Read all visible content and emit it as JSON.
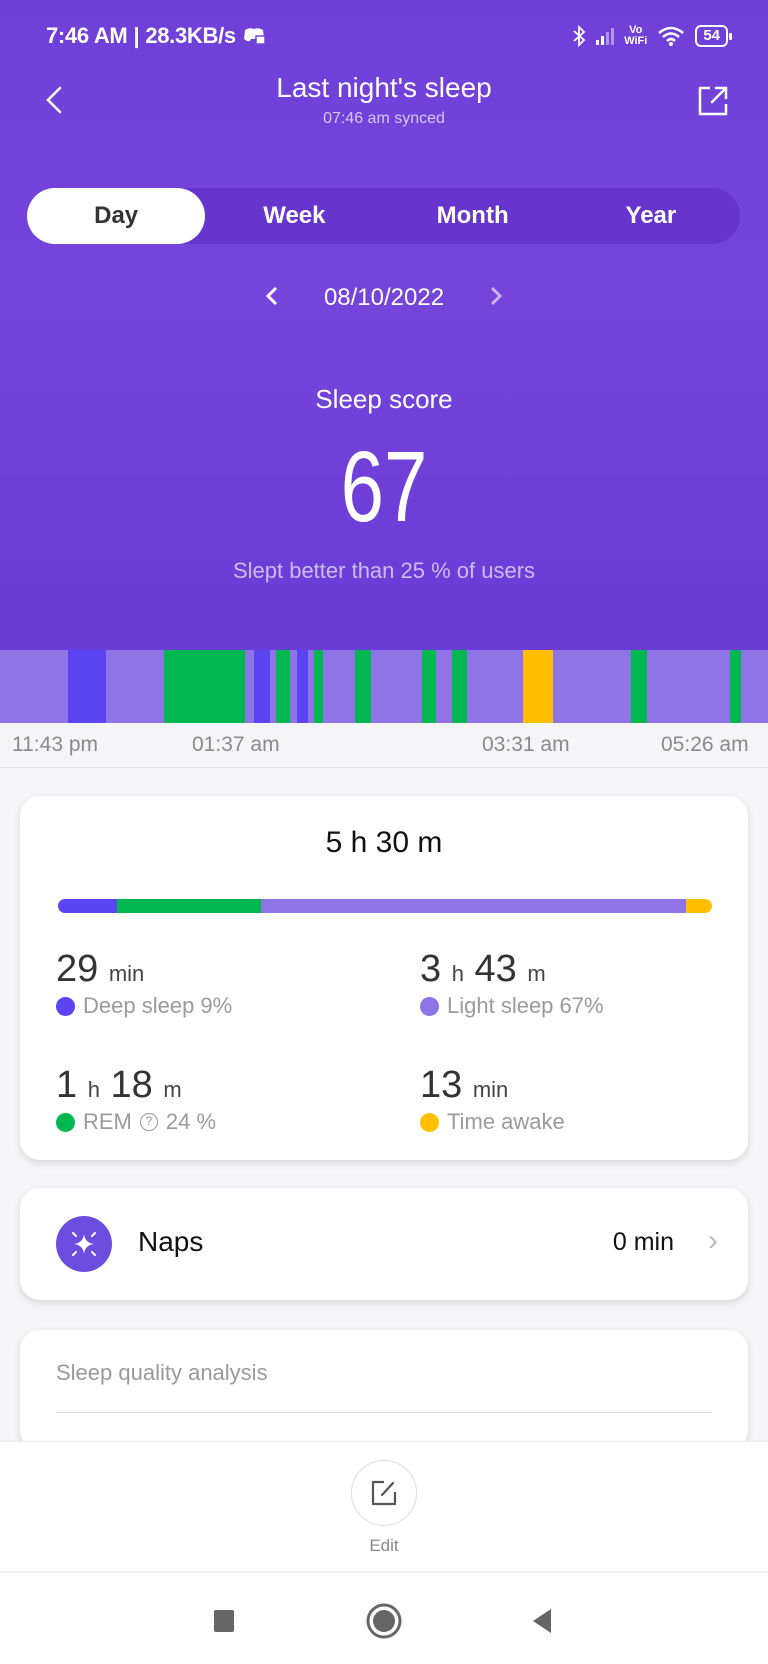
{
  "status_bar": {
    "time": "7:46 AM",
    "network_speed": "28.3KB/s",
    "vowifi_label": "Vo\nWiFi",
    "battery": "54",
    "icons": [
      "discord-icon",
      "bluetooth-icon",
      "signal-icon",
      "vowifi-icon",
      "wifi-icon",
      "battery-icon"
    ]
  },
  "header": {
    "title": "Last night's sleep",
    "subtitle": "07:46 am synced",
    "back_icon": "chevron-left-icon",
    "share_icon": "share-icon"
  },
  "tabs": [
    {
      "label": "Day",
      "active": true
    },
    {
      "label": "Week",
      "active": false
    },
    {
      "label": "Month",
      "active": false
    },
    {
      "label": "Year",
      "active": false
    }
  ],
  "date_nav": {
    "date": "08/10/2022",
    "prev_icon": "chevron-left-icon",
    "next_icon": "chevron-right-icon"
  },
  "score": {
    "label": "Sleep score",
    "value": "67",
    "comparison": "Slept better than 25 % of users"
  },
  "colors": {
    "deep": "#5b44f2",
    "light": "#8f74e8",
    "rem": "#00b84f",
    "awake": "#ffbf00",
    "brand": "#7243da"
  },
  "timeline": {
    "start_label": "11:43 pm",
    "end_label": "05:26 am",
    "tick_labels": [
      "11:43 pm",
      "01:37 am",
      "03:31 am",
      "05:26 am"
    ],
    "segments_fraction": [
      {
        "stage": "light",
        "start": 0.0,
        "end": 0.089
      },
      {
        "stage": "deep",
        "start": 0.089,
        "end": 0.138
      },
      {
        "stage": "light",
        "start": 0.138,
        "end": 0.214
      },
      {
        "stage": "rem",
        "start": 0.214,
        "end": 0.319
      },
      {
        "stage": "light",
        "start": 0.319,
        "end": 0.331
      },
      {
        "stage": "deep",
        "start": 0.331,
        "end": 0.352
      },
      {
        "stage": "light",
        "start": 0.352,
        "end": 0.359
      },
      {
        "stage": "rem",
        "start": 0.359,
        "end": 0.378
      },
      {
        "stage": "light",
        "start": 0.378,
        "end": 0.387
      },
      {
        "stage": "deep",
        "start": 0.387,
        "end": 0.401
      },
      {
        "stage": "light",
        "start": 0.401,
        "end": 0.409
      },
      {
        "stage": "rem",
        "start": 0.409,
        "end": 0.421
      },
      {
        "stage": "light",
        "start": 0.421,
        "end": 0.462
      },
      {
        "stage": "rem",
        "start": 0.462,
        "end": 0.483
      },
      {
        "stage": "light",
        "start": 0.483,
        "end": 0.549
      },
      {
        "stage": "rem",
        "start": 0.549,
        "end": 0.568
      },
      {
        "stage": "light",
        "start": 0.568,
        "end": 0.589
      },
      {
        "stage": "rem",
        "start": 0.589,
        "end": 0.608
      },
      {
        "stage": "light",
        "start": 0.608,
        "end": 0.681
      },
      {
        "stage": "awake",
        "start": 0.681,
        "end": 0.72
      },
      {
        "stage": "light",
        "start": 0.72,
        "end": 0.822
      },
      {
        "stage": "rem",
        "start": 0.822,
        "end": 0.842
      },
      {
        "stage": "light",
        "start": 0.842,
        "end": 0.95
      },
      {
        "stage": "rem",
        "start": 0.95,
        "end": 0.965
      },
      {
        "stage": "light",
        "start": 0.965,
        "end": 1.0
      }
    ]
  },
  "summary": {
    "total": "5 h 30 m",
    "breakdown_fraction": [
      {
        "stage": "deep",
        "fraction": 0.09
      },
      {
        "stage": "rem",
        "fraction": 0.22
      },
      {
        "stage": "light",
        "fraction": 0.65
      },
      {
        "stage": "awake",
        "fraction": 0.04
      }
    ],
    "stats": {
      "deep": {
        "n1": "29",
        "u1": "min",
        "n2": "",
        "u2": "",
        "label": "Deep sleep 9%"
      },
      "light": {
        "n1": "3",
        "u1": "h",
        "n2": "43",
        "u2": "m",
        "label": "Light sleep 67%"
      },
      "rem": {
        "n1": "1",
        "u1": "h",
        "n2": "18",
        "u2": "m",
        "label": "REM",
        "pct": "24 %",
        "help_icon": "question-circle-icon"
      },
      "awake": {
        "n1": "13",
        "u1": "min",
        "n2": "",
        "u2": "",
        "label": "Time awake"
      }
    }
  },
  "naps": {
    "icon": "sparkle-icon",
    "label": "Naps",
    "value": "0 min",
    "chevron": "›"
  },
  "quality": {
    "title": "Sleep quality analysis"
  },
  "edit": {
    "label": "Edit",
    "icon": "edit-icon"
  },
  "system_nav": {
    "recents_icon": "square-icon",
    "home_icon": "circle-icon",
    "back_icon": "triangle-back-icon"
  }
}
